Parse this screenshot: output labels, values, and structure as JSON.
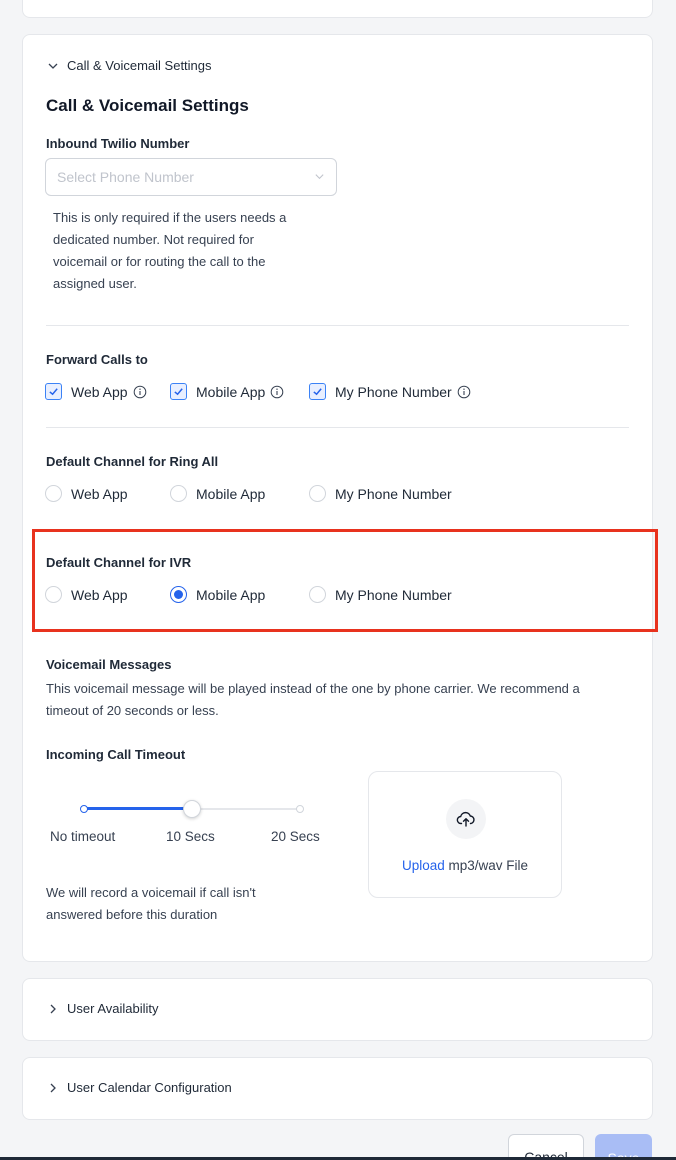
{
  "call_voicemail": {
    "section_toggle": "Call & Voicemail Settings",
    "title": "Call & Voicemail Settings",
    "inbound_number": {
      "label": "Inbound Twilio Number",
      "placeholder": "Select Phone Number",
      "help": [
        "This is only required if the users needs a",
        "dedicated number. Not required for",
        "voicemail or for routing the call to the",
        "assigned user."
      ]
    },
    "forward_calls": {
      "label": "Forward Calls to",
      "options": [
        {
          "label": "Web App",
          "checked": true
        },
        {
          "label": "Mobile App",
          "checked": true
        },
        {
          "label": "My Phone Number",
          "checked": true
        }
      ]
    },
    "ring_all": {
      "label": "Default Channel for Ring All",
      "options": [
        "Web App",
        "Mobile App",
        "My Phone Number"
      ],
      "selected": null
    },
    "ivr": {
      "label": "Default Channel for IVR",
      "options": [
        "Web App",
        "Mobile App",
        "My Phone Number"
      ],
      "selected": "Mobile App"
    },
    "voicemail": {
      "label": "Voicemail Messages",
      "description_line1": "This voicemail message will be played instead of the one by phone carrier. We recommend a",
      "description_line2": "timeout of 20 seconds or less."
    },
    "timeout": {
      "label": "Incoming Call Timeout",
      "ticks": [
        "No timeout",
        "10 Secs",
        "20 Secs"
      ],
      "value": "10 Secs",
      "value_fraction": 0.5,
      "note_line1": "We will record a voicemail if call isn't",
      "note_line2": "answered before this duration"
    },
    "upload": {
      "link": "Upload",
      "suffix": " mp3/wav File",
      "icon": "upload-cloud-icon"
    }
  },
  "user_availability": {
    "label": "User Availability"
  },
  "user_calendar": {
    "label": "User Calendar Configuration"
  },
  "actions": {
    "cancel": "Cancel",
    "save": "Save"
  },
  "colors": {
    "accent": "#2563eb",
    "highlight": "#e8321e",
    "save_disabled": "#a9bdf5"
  }
}
